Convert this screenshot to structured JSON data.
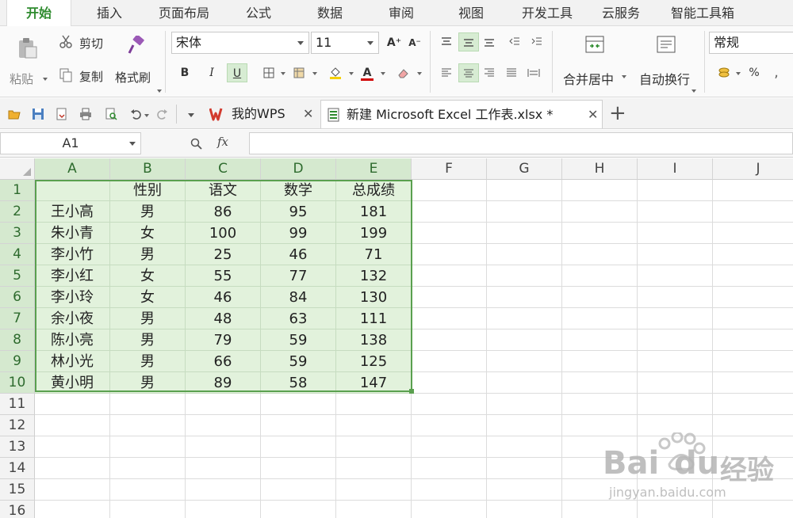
{
  "menu": {
    "tabs": [
      {
        "label": "开始",
        "active": true
      },
      {
        "label": "插入"
      },
      {
        "label": "页面布局"
      },
      {
        "label": "公式"
      },
      {
        "label": "数据"
      },
      {
        "label": "审阅"
      },
      {
        "label": "视图"
      },
      {
        "label": "开发工具"
      },
      {
        "label": "云服务"
      },
      {
        "label": "智能工具箱"
      }
    ]
  },
  "ribbon": {
    "paste_label": "粘贴",
    "cut_label": "剪切",
    "copy_label": "复制",
    "format_painter_label": "格式刷",
    "font_name": "宋体",
    "font_size": "11",
    "bold_label": "B",
    "italic_label": "I",
    "underline_label": "U",
    "increase_font_label": "A⁺",
    "decrease_font_label": "A⁻",
    "font_color_label": "A",
    "merge_center_label": "合并居中",
    "wrap_text_label": "自动换行",
    "number_format": "常规",
    "percent_label": "%",
    "accent_color": "#2e8b2e"
  },
  "doc_tabs": [
    {
      "label": "我的WPS",
      "active": false
    },
    {
      "label": "新建 Microsoft Excel 工作表.xlsx *",
      "active": true
    }
  ],
  "formula_bar": {
    "cell_ref": "A1",
    "fx_label": "fx",
    "value": ""
  },
  "sheet": {
    "columns": [
      "A",
      "B",
      "C",
      "D",
      "E",
      "F",
      "G",
      "H",
      "I",
      "J"
    ],
    "rows": [
      "1",
      "2",
      "3",
      "4",
      "5",
      "6",
      "7",
      "8",
      "9",
      "10",
      "11",
      "12",
      "13",
      "14",
      "15",
      "16"
    ],
    "header": [
      "",
      "性别",
      "语文",
      "数学",
      "总成绩"
    ],
    "data": [
      [
        "王小高",
        "男",
        "86",
        "95",
        "181"
      ],
      [
        "朱小青",
        "女",
        "100",
        "99",
        "199"
      ],
      [
        "李小竹",
        "男",
        "25",
        "46",
        "71"
      ],
      [
        "李小红",
        "女",
        "55",
        "77",
        "132"
      ],
      [
        "李小玲",
        "女",
        "46",
        "84",
        "130"
      ],
      [
        "余小夜",
        "男",
        "48",
        "63",
        "111"
      ],
      [
        "陈小亮",
        "男",
        "79",
        "59",
        "138"
      ],
      [
        "林小光",
        "男",
        "66",
        "59",
        "125"
      ],
      [
        "黄小明",
        "男",
        "89",
        "58",
        "147"
      ]
    ],
    "selection_color": "#5aa04f"
  },
  "watermark": {
    "brand": "Bai",
    "brand2": "du",
    "product": "经验",
    "url": "jingyan.baidu.com"
  }
}
